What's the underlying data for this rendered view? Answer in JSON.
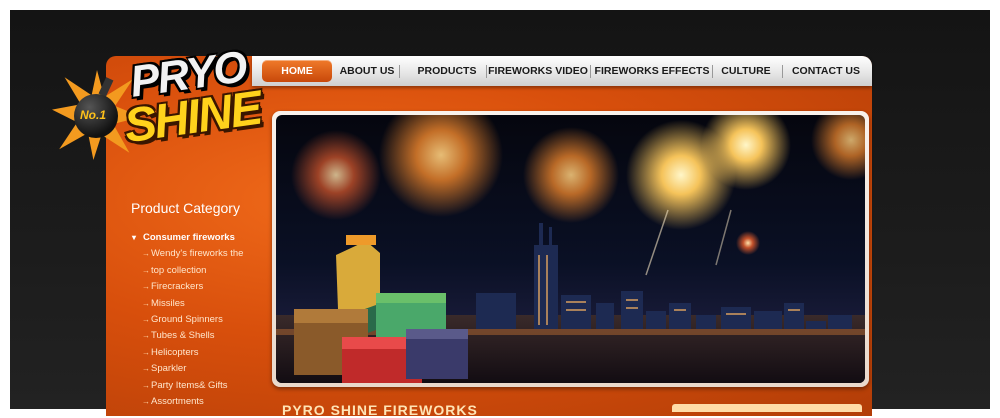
{
  "logo": {
    "line1": "PRYO",
    "line2": "SHINE",
    "badge": "No.1"
  },
  "nav": [
    {
      "label": "HOME",
      "active": true
    },
    {
      "label": "ABOUT US"
    },
    {
      "label": "PRODUCTS"
    },
    {
      "label": "FIREWORKS VIDEO"
    },
    {
      "label": "FIREWORKS EFFECTS"
    },
    {
      "label": "CULTURE"
    },
    {
      "label": "CONTACT US"
    }
  ],
  "category": {
    "title": "Product Category",
    "head": "Consumer fireworks",
    "items": [
      "Wendy's fireworks the",
      "top collection",
      "Firecrackers",
      "Missiles",
      "Ground Spinners",
      "Tubes & Shells",
      "Helicopters",
      "Sparkler",
      "Party Items& Gifts",
      "Assortments"
    ]
  },
  "banner": {
    "alt": "fireworks over city skyline with product boxes"
  },
  "footer_heading": "PYRO SHINE FIREWORKS",
  "colors": {
    "accent": "#d84f0c",
    "nav_active": "#e0621a",
    "logo_yellow": "#ffd21c"
  }
}
